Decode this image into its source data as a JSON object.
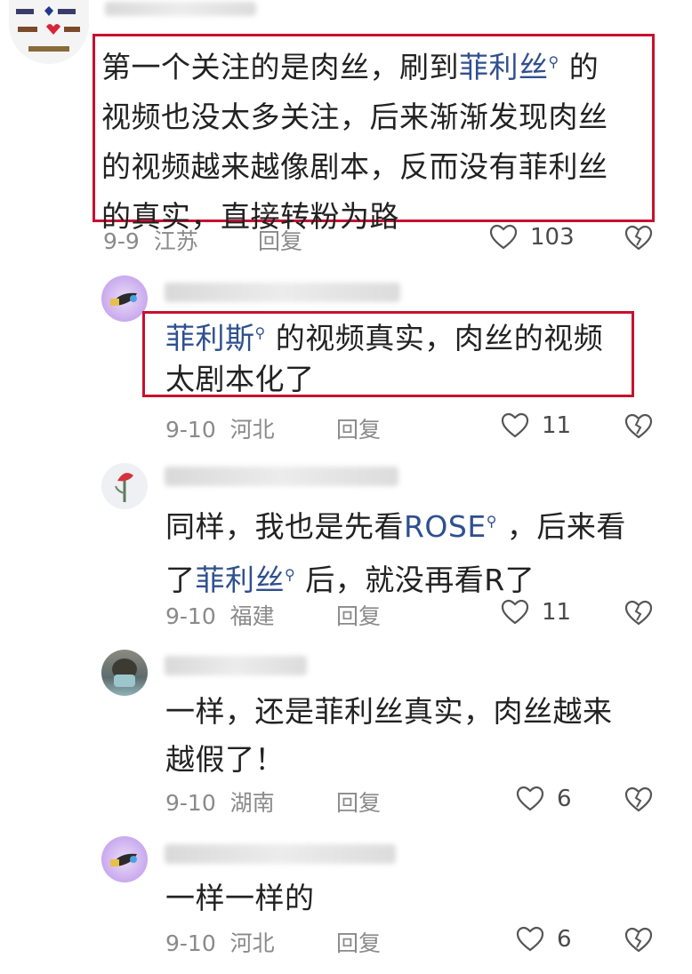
{
  "comments": [
    {
      "text_before": "第一个关注的是肉丝，刷到",
      "mention": "菲利丝",
      "text_after_line1": "的",
      "line2": "视频也没太多关注，后来渐渐发现肉丝",
      "line3": "的视频越来越像剧本，反而没有菲利丝",
      "line4": "的真实，直接转粉为路",
      "date": "9-9",
      "location": "江苏",
      "reply_label": "回复",
      "likes": "103"
    },
    {
      "mention": "菲利斯",
      "line1_after": "的视频真实，肉丝的视频",
      "line2": "太剧本化了",
      "date": "9-10",
      "location": "河北",
      "reply_label": "回复",
      "likes": "11"
    },
    {
      "line1_before": "同样，我也是先看",
      "mention1": "ROSE",
      "line1_after": "，后来看",
      "line2_before": "了",
      "mention2": "菲利丝",
      "line2_after": "后，就没再看R了",
      "date": "9-10",
      "location": "福建",
      "reply_label": "回复",
      "likes": "11"
    },
    {
      "line1": "一样，还是菲利丝真实，肉丝越来",
      "line2": "越假了！",
      "date": "9-10",
      "location": "湖南",
      "reply_label": "回复",
      "likes": "6"
    },
    {
      "line1": "一样一样的",
      "date": "9-10",
      "location": "河北",
      "reply_label": "回复",
      "likes": "6"
    }
  ],
  "icons": {
    "mention": "search-icon",
    "like": "heart-outline-icon",
    "dislike": "broken-heart-icon"
  },
  "colors": {
    "highlight_box": "#c8102e",
    "mention_link": "#2f4f8f",
    "meta_text": "#8a8a8a"
  }
}
